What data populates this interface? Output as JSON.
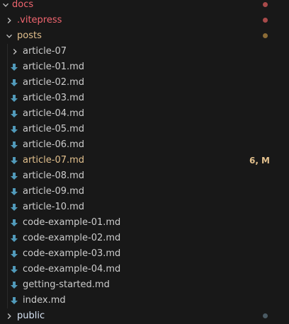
{
  "colors": {
    "background": "#181818",
    "default_text": "#cccccc",
    "error_red": "#f0656f",
    "modified_orange": "#e2c08d",
    "markdown_icon": "#519aba",
    "error_dot": "#a84a4a",
    "modified_dot": "#8b6b36",
    "neutral_dot": "#4a5a63",
    "folder_label": "#d7e3f4"
  },
  "tree": {
    "docs": {
      "label": "docs",
      "icon": "chevron-down-icon",
      "decoration": "error"
    },
    "vitepress": {
      "label": ".vitepress",
      "icon": "chevron-right-icon",
      "decoration": "error"
    },
    "posts": {
      "label": "posts",
      "icon": "chevron-down-icon",
      "decoration": "modified"
    },
    "article07_folder": {
      "label": "article-07",
      "icon": "chevron-right-icon"
    },
    "files": [
      {
        "label": "article-01.md",
        "icon": "markdown-arrow-icon"
      },
      {
        "label": "article-02.md",
        "icon": "markdown-arrow-icon"
      },
      {
        "label": "article-03.md",
        "icon": "markdown-arrow-icon"
      },
      {
        "label": "article-04.md",
        "icon": "markdown-arrow-icon"
      },
      {
        "label": "article-05.md",
        "icon": "markdown-arrow-icon"
      },
      {
        "label": "article-06.md",
        "icon": "markdown-arrow-icon"
      },
      {
        "label": "article-07.md",
        "icon": "markdown-arrow-icon",
        "status": "6, M"
      },
      {
        "label": "article-08.md",
        "icon": "markdown-arrow-icon"
      },
      {
        "label": "article-09.md",
        "icon": "markdown-arrow-icon"
      },
      {
        "label": "article-10.md",
        "icon": "markdown-arrow-icon"
      },
      {
        "label": "code-example-01.md",
        "icon": "markdown-arrow-icon"
      },
      {
        "label": "code-example-02.md",
        "icon": "markdown-arrow-icon"
      },
      {
        "label": "code-example-03.md",
        "icon": "markdown-arrow-icon"
      },
      {
        "label": "code-example-04.md",
        "icon": "markdown-arrow-icon"
      },
      {
        "label": "getting-started.md",
        "icon": "markdown-arrow-icon"
      },
      {
        "label": "index.md",
        "icon": "markdown-arrow-icon"
      }
    ],
    "public": {
      "label": "public",
      "icon": "chevron-right-icon",
      "decoration": "neutral"
    }
  }
}
